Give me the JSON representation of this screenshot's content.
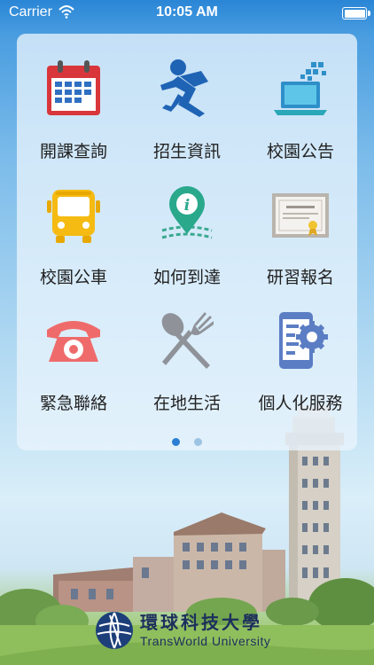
{
  "status_bar": {
    "carrier": "Carrier",
    "time": "10:05 AM"
  },
  "menu": {
    "items": [
      {
        "label": "開課查詢",
        "icon": "calendar-icon"
      },
      {
        "label": "招生資訊",
        "icon": "running-person-icon"
      },
      {
        "label": "校園公告",
        "icon": "laptop-icon"
      },
      {
        "label": "校園公車",
        "icon": "bus-icon"
      },
      {
        "label": "如何到達",
        "icon": "map-pin-icon"
      },
      {
        "label": "研習報名",
        "icon": "certificate-icon"
      },
      {
        "label": "緊急聯絡",
        "icon": "telephone-icon"
      },
      {
        "label": "在地生活",
        "icon": "fork-spoon-icon"
      },
      {
        "label": "個人化服務",
        "icon": "phone-gear-icon"
      }
    ]
  },
  "pager": {
    "pages": 2,
    "current": 1,
    "active_color": "#2a7fd4",
    "inactive_color": "#9cc3e2"
  },
  "university": {
    "name_zh": "環球科技大學",
    "name_en": "TransWorld  University"
  }
}
